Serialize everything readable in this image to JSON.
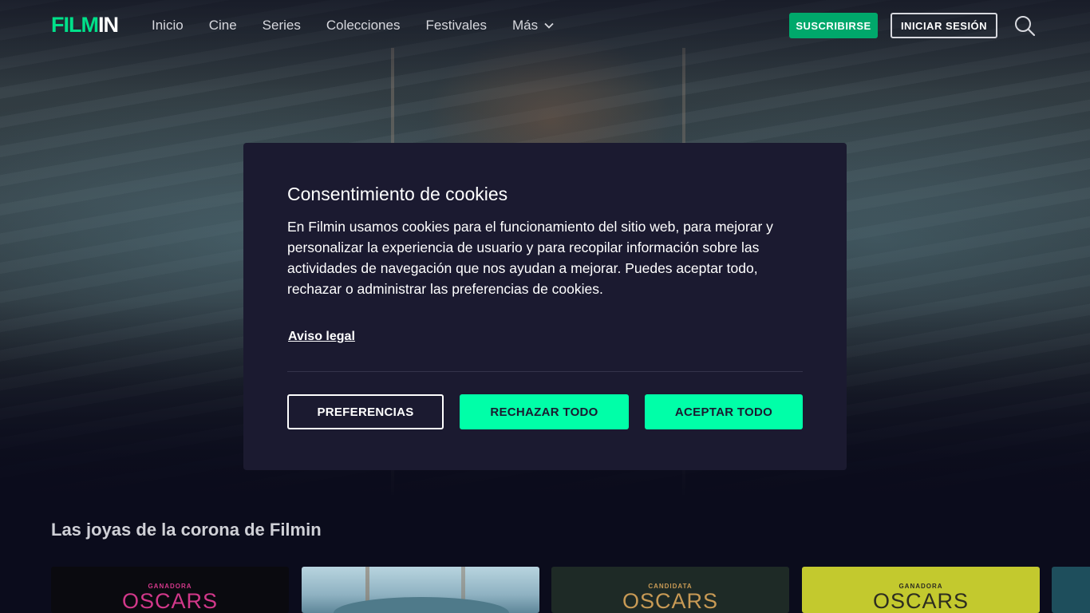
{
  "header": {
    "logo_part1": "FILM",
    "logo_part2": "IN",
    "nav": [
      {
        "label": "Inicio"
      },
      {
        "label": "Cine"
      },
      {
        "label": "Series"
      },
      {
        "label": "Colecciones"
      },
      {
        "label": "Festivales"
      },
      {
        "label": "Más"
      }
    ],
    "subscribe_label": "SUSCRIBIRSE",
    "login_label": "INICIAR SESIÓN"
  },
  "modal": {
    "title": "Consentimiento de cookies",
    "body": "En Filmin usamos cookies para el funcionamiento del sitio web, para mejorar y personalizar la experiencia de usuario y para recopilar información sobre las actividades de navegación que nos ayudan a mejorar. Puedes aceptar todo, rechazar o administrar las preferencias de cookies.",
    "legal_link": "Aviso legal",
    "btn_preferences": "PREFERENCIAS",
    "btn_reject": "RECHAZAR TODO",
    "btn_accept": "ACEPTAR TODO"
  },
  "section": {
    "title": "Las joyas de la corona de Filmin",
    "cards": [
      {
        "badge_top": "GANADORA",
        "badge_main": "OSCARS"
      },
      {
        "badge_top": "",
        "badge_main": ""
      },
      {
        "badge_top": "CANDIDATA",
        "badge_main": "OSCARS"
      },
      {
        "badge_top": "GANADORA",
        "badge_main": "OSCARS"
      }
    ]
  },
  "colors": {
    "brand_green": "#00e08a",
    "accent_button": "#00ffa8",
    "subscribe_button": "#00a86b",
    "modal_background": "#1b1a30",
    "page_background": "#0b0c1c"
  },
  "icons": [
    "search-icon",
    "chevron-down-icon"
  ]
}
